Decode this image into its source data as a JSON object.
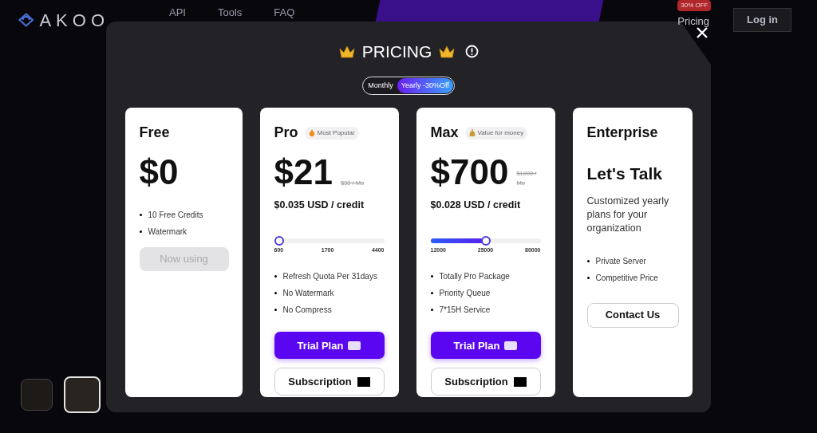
{
  "nav": {
    "logo": "AKOO",
    "links": [
      "API",
      "Tools",
      "FAQ"
    ],
    "pricing": "Pricing",
    "badge": "30% OFF",
    "login": "Log in"
  },
  "modal": {
    "title": "PRICING",
    "toggle": [
      {
        "label": "Monthly",
        "selected": false
      },
      {
        "label": "Yearly -30%Off",
        "selected": true
      }
    ]
  },
  "plans": [
    {
      "kind": "free",
      "name": "Free",
      "price": "$0",
      "features": [
        "10 Free Credits",
        "Watermark"
      ],
      "button": "Now using"
    },
    {
      "kind": "paid",
      "name": "Pro",
      "tag": "Most Popular",
      "price": "$21",
      "old_price": "$30 / Mo",
      "per_credit": "$0.035 USD / credit",
      "slider": {
        "level": 0,
        "ticks": [
          "600",
          "1700",
          "4400"
        ]
      },
      "features": [
        "Refresh Quota Per 31days",
        "No Watermark",
        "No Compress"
      ],
      "trial": "Trial Plan",
      "subscription": "Subscription"
    },
    {
      "kind": "paid",
      "name": "Max",
      "tag": "Value for money",
      "price": "$700",
      "old_price": "$1000 / Mo",
      "per_credit": "$0.028 USD / credit",
      "slider": {
        "level": 0.5,
        "ticks": [
          "12000",
          "25000",
          "80000"
        ]
      },
      "features": [
        "Totally Pro Package",
        "Priority Queue",
        "7*15H Service"
      ],
      "trial": "Trial Plan",
      "subscription": "Subscription"
    },
    {
      "kind": "enterprise",
      "name": "Enterprise",
      "headline": "Let's Talk",
      "description": "Customized yearly plans for your organization",
      "features": [
        "Private Server",
        "Competitive Price"
      ],
      "button": "Contact Us"
    }
  ],
  "thumbnails": [
    {
      "selected": false
    },
    {
      "selected": true
    }
  ]
}
